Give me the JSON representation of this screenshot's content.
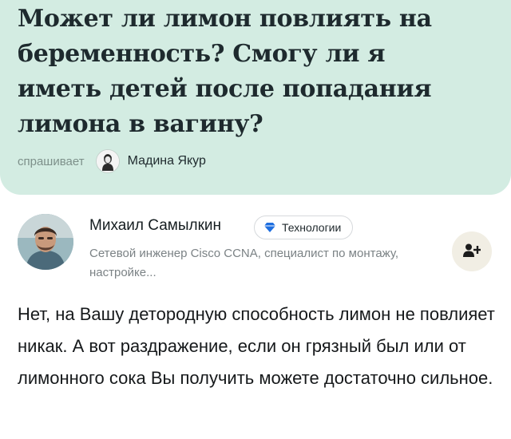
{
  "question": {
    "title": "Может ли лимон повлиять на беременность? Смогу ли я иметь детей после попадания лимона в вагину?",
    "asks_label": "спрашивает",
    "asker_name": "Мадина Якур"
  },
  "answer": {
    "author_name": "Михаил Самылкин",
    "topic_chip": "Технологии",
    "author_bio": "Сетевой инженер Cisco CCNA, специалист по монтажу, настройке...",
    "text": "Нет, на Вашу детородную способность лимон не повлияет никак. А вот раздражение, если он грязный был или от лимонного сока Вы получить можете достаточно сильное."
  },
  "icons": {
    "asker_avatar": "user-avatar-icon",
    "topic": "diamond-icon",
    "follow": "add-user-icon"
  },
  "colors": {
    "question_card_bg": "#d3ece2",
    "follow_button_bg": "#f1eee4",
    "bio_text": "#7b8285"
  }
}
